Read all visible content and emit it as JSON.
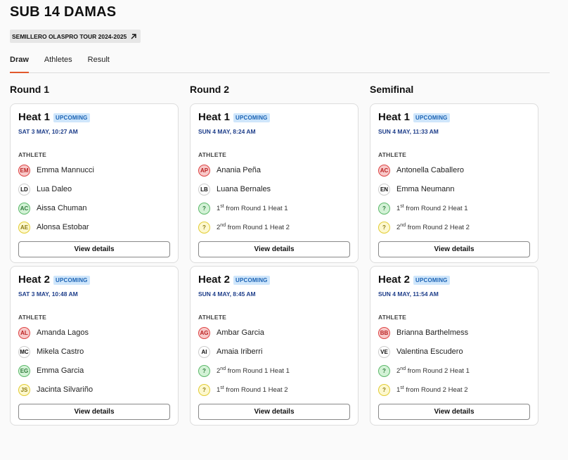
{
  "page": {
    "title": "SUB 14 DAMAS",
    "tour_chip": "SEMILLERO OLASPRO TOUR 2024-2025"
  },
  "tabs": [
    "Draw",
    "Athletes",
    "Result"
  ],
  "active_tab": "Draw",
  "colors": {
    "tab_accent": "#e2592d",
    "badge_bg": "#cfe6fb",
    "badge_text": "#1b63b4",
    "time_text": "#1e3e8a"
  },
  "columns": [
    {
      "title": "Round 1",
      "heats": [
        {
          "title": "Heat 1",
          "status": "UPCOMING",
          "time": "SAT 3 MAY, 10:27 AM",
          "athlete_label": "ATHLETE",
          "athletes": [
            {
              "initials": "EM",
              "name": "Emma Mannucci",
              "color": "red"
            },
            {
              "initials": "LD",
              "name": "Lua Daleo",
              "color": "white"
            },
            {
              "initials": "AC",
              "name": "Aissa Chuman",
              "color": "green"
            },
            {
              "initials": "AE",
              "name": "Alonsa Estobar",
              "color": "yellow"
            }
          ],
          "button": "View details"
        },
        {
          "title": "Heat 2",
          "status": "UPCOMING",
          "time": "SAT 3 MAY, 10:48 AM",
          "athlete_label": "ATHLETE",
          "athletes": [
            {
              "initials": "AL",
              "name": "Amanda Lagos",
              "color": "red"
            },
            {
              "initials": "MC",
              "name": "Mikela Castro",
              "color": "white"
            },
            {
              "initials": "EG",
              "name": "Emma Garcia",
              "color": "green"
            },
            {
              "initials": "JS",
              "name": "Jacinta Silvariño",
              "color": "yellow"
            }
          ],
          "button": "View details"
        }
      ]
    },
    {
      "title": "Round 2",
      "heats": [
        {
          "title": "Heat 1",
          "status": "UPCOMING",
          "time": "SUN 4 MAY, 8:24 AM",
          "athlete_label": "ATHLETE",
          "athletes": [
            {
              "initials": "AP",
              "name": "Anania Peña",
              "color": "red"
            },
            {
              "initials": "LB",
              "name": "Luana Bernales",
              "color": "white"
            },
            {
              "initials": "?",
              "rank": "1",
              "suffix": "st",
              "source": "from Round 1 Heat 1",
              "color": "green"
            },
            {
              "initials": "?",
              "rank": "2",
              "suffix": "nd",
              "source": "from Round 1 Heat 2",
              "color": "yellow"
            }
          ],
          "button": "View details"
        },
        {
          "title": "Heat 2",
          "status": "UPCOMING",
          "time": "SUN 4 MAY, 8:45 AM",
          "athlete_label": "ATHLETE",
          "athletes": [
            {
              "initials": "AG",
              "name": "Ambar Garcia",
              "color": "red"
            },
            {
              "initials": "AI",
              "name": "Amaia Iriberri",
              "color": "white"
            },
            {
              "initials": "?",
              "rank": "2",
              "suffix": "nd",
              "source": "from Round 1 Heat 1",
              "color": "green"
            },
            {
              "initials": "?",
              "rank": "1",
              "suffix": "st",
              "source": "from Round 1 Heat 2",
              "color": "yellow"
            }
          ],
          "button": "View details"
        }
      ]
    },
    {
      "title": "Semifinal",
      "heats": [
        {
          "title": "Heat 1",
          "status": "UPCOMING",
          "time": "SUN 4 MAY, 11:33 AM",
          "athlete_label": "ATHLETE",
          "athletes": [
            {
              "initials": "AC",
              "name": "Antonella Caballero",
              "color": "red"
            },
            {
              "initials": "EN",
              "name": "Emma Neumann",
              "color": "white"
            },
            {
              "initials": "?",
              "rank": "1",
              "suffix": "st",
              "source": "from Round 2 Heat 1",
              "color": "green"
            },
            {
              "initials": "?",
              "rank": "2",
              "suffix": "nd",
              "source": "from Round 2 Heat 2",
              "color": "yellow"
            }
          ],
          "button": "View details"
        },
        {
          "title": "Heat 2",
          "status": "UPCOMING",
          "time": "SUN 4 MAY, 11:54 AM",
          "athlete_label": "ATHLETE",
          "athletes": [
            {
              "initials": "BB",
              "name": "Brianna Barthelmess",
              "color": "red"
            },
            {
              "initials": "VE",
              "name": "Valentina Escudero",
              "color": "white"
            },
            {
              "initials": "?",
              "rank": "2",
              "suffix": "nd",
              "source": "from Round 2 Heat 1",
              "color": "green"
            },
            {
              "initials": "?",
              "rank": "1",
              "suffix": "st",
              "source": "from Round 2 Heat 2",
              "color": "yellow"
            }
          ],
          "button": "View details"
        }
      ]
    }
  ]
}
